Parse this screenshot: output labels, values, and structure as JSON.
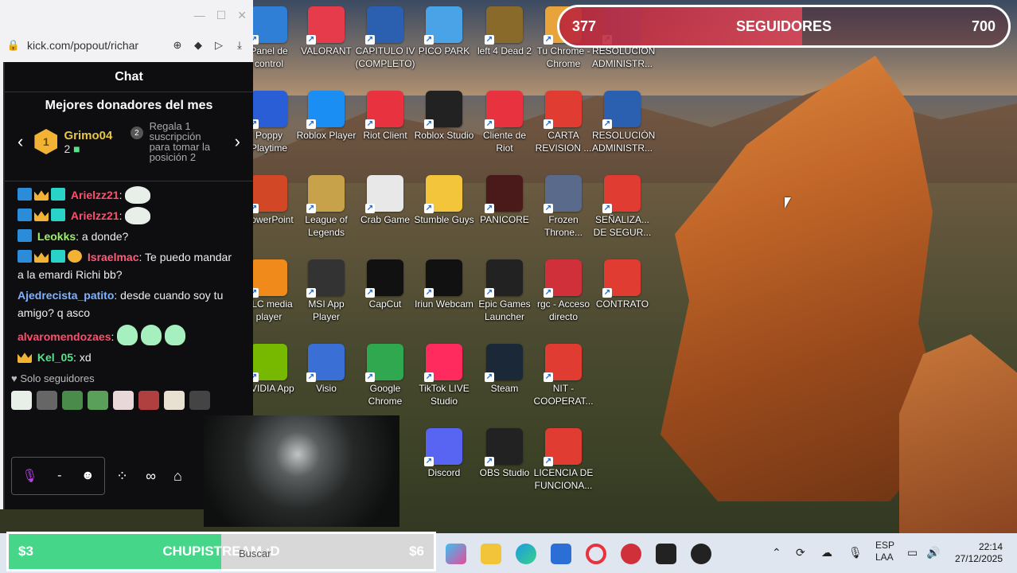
{
  "browser": {
    "url": "kick.com/popout/richar"
  },
  "chat": {
    "title": "Chat",
    "donors": {
      "heading": "Mejores donadores del mes",
      "top_rank": "1",
      "top_name": "Grimo04",
      "top_count": "2",
      "next_rank": "2",
      "next_text": "Regala 1 suscripción para tomar la posición 2"
    },
    "messages": [
      {
        "user": "Arielzz21",
        "text": ""
      },
      {
        "user": "Arielzz21",
        "text": ""
      },
      {
        "user": "Leokks",
        "text": "a donde?"
      },
      {
        "user": "Israelmac",
        "text": "Te puedo mandar a la emardi Richi bb?"
      },
      {
        "user": "Ajedrecista_patito",
        "text": "desde cuando soy tu amigo? q asco"
      },
      {
        "user": "alvaromendozaes",
        "text": ""
      },
      {
        "user": "Kel_05",
        "text": "xd"
      }
    ],
    "followers_only": "Solo seguidores",
    "input_separator": "-"
  },
  "follower_goal": {
    "current": "377",
    "label": "SEGUIDORES",
    "target": "700",
    "progress": 0.54
  },
  "donation_goal": {
    "current": "$3",
    "label": "CHUPISTREAM :D",
    "target": "$6",
    "progress": 0.5
  },
  "desktop_icons": [
    {
      "label": "Panel de control",
      "color": "#2f7fd6"
    },
    {
      "label": "VALORANT",
      "color": "#e63b4b"
    },
    {
      "label": "CAPITULO IV (COMPLETO)",
      "color": "#2b5fb0"
    },
    {
      "label": "PICO PARK",
      "color": "#4aa3e6"
    },
    {
      "label": "left 4 Dead 2",
      "color": "#8a6a2a"
    },
    {
      "label": "Tu Chrome - Chrome",
      "color": "#e8a43a"
    },
    {
      "label": "RESOLUCION ADMINISTR...",
      "color": "#2b5fb0"
    },
    {
      "label": "Poppy Playtime",
      "color": "#2a5ed6"
    },
    {
      "label": "Roblox Player",
      "color": "#1a8ef2"
    },
    {
      "label": "Riot Client",
      "color": "#e8323f"
    },
    {
      "label": "Roblox Studio",
      "color": "#222"
    },
    {
      "label": "Cliente de Riot",
      "color": "#e8323f"
    },
    {
      "label": "CARTA REVISION ...",
      "color": "#e03c31"
    },
    {
      "label": "RESOLUCIÓN ADMINISTR...",
      "color": "#2b5fb0"
    },
    {
      "label": "PowerPoint",
      "color": "#d24726"
    },
    {
      "label": "League of Legends",
      "color": "#c8a24a"
    },
    {
      "label": "Crab Game",
      "color": "#e8e8e8"
    },
    {
      "label": "Stumble Guys",
      "color": "#f2c53a"
    },
    {
      "label": "PANICORE",
      "color": "#4a1a1a"
    },
    {
      "label": "Frozen Throne...",
      "color": "#5a6a8a"
    },
    {
      "label": "SEÑALIZA... DE SEGUR...",
      "color": "#e03c31"
    },
    {
      "label": "VLC media player",
      "color": "#f08a1a"
    },
    {
      "label": "MSI App Player",
      "color": "#333"
    },
    {
      "label": "CapCut",
      "color": "#111"
    },
    {
      "label": "Iriun Webcam",
      "color": "#111"
    },
    {
      "label": "Epic Games Launcher",
      "color": "#222"
    },
    {
      "label": "rgc - Acceso directo",
      "color": "#d0303a"
    },
    {
      "label": "CONTRATO",
      "color": "#e03c31"
    },
    {
      "label": "NVIDIA App",
      "color": "#76b900"
    },
    {
      "label": "Visio",
      "color": "#3a6fd6"
    },
    {
      "label": "Google Chrome",
      "color": "#2fa84f"
    },
    {
      "label": "TikTok LIVE Studio",
      "color": "#ff2b5e"
    },
    {
      "label": "Steam",
      "color": "#1b2838"
    },
    {
      "label": "NIT - COOPERAT...",
      "color": "#e03c31"
    },
    {
      "label": "Discord",
      "color": "#5865f2"
    },
    {
      "label": "OBS Studio",
      "color": "#222"
    },
    {
      "label": "LICENCIA DE FUNCIONA...",
      "color": "#e03c31"
    }
  ],
  "taskbar": {
    "search_placeholder": "Buscar",
    "lang_top": "ESP",
    "lang_bottom": "LAA",
    "time": "22:14",
    "date": "27/12/2025"
  }
}
